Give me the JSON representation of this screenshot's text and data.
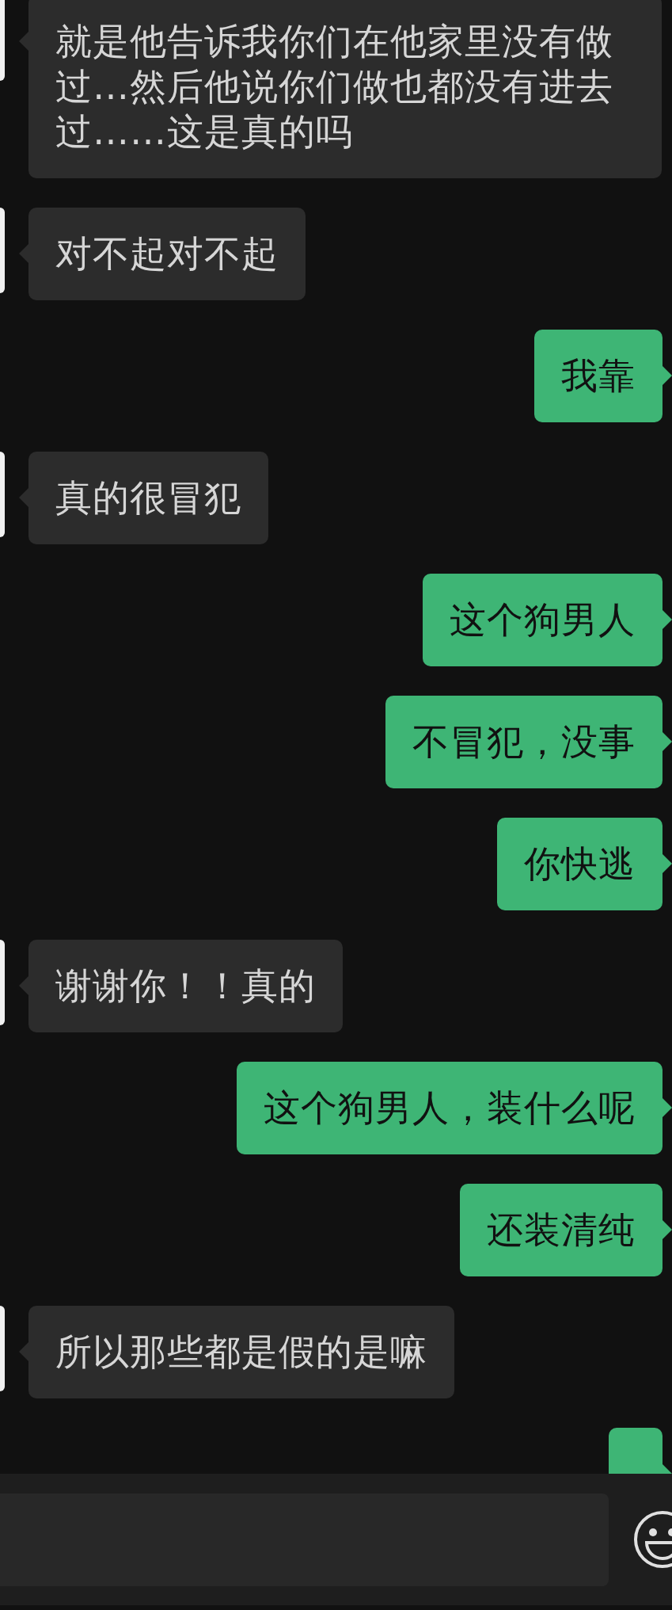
{
  "messages": [
    {
      "kind": "in",
      "text": "就是他告诉我你们在他家里没有做过…然后他说你们做也都没有进去过……这是真的吗"
    },
    {
      "kind": "in",
      "text": "对不起对不起"
    },
    {
      "kind": "out",
      "text": "我靠"
    },
    {
      "kind": "in",
      "text": "真的很冒犯"
    },
    {
      "kind": "out",
      "text": "这个狗男人"
    },
    {
      "kind": "out",
      "text": "不冒犯，没事"
    },
    {
      "kind": "out",
      "text": "你快逃"
    },
    {
      "kind": "in",
      "text": "谢谢你！！真的"
    },
    {
      "kind": "out",
      "text": "这个狗男人，装什么呢"
    },
    {
      "kind": "out",
      "text": "还装清纯"
    },
    {
      "kind": "in",
      "text": "所以那些都是假的是嘛"
    },
    {
      "kind": "out"
    }
  ],
  "input": {
    "kind": "text"
  }
}
